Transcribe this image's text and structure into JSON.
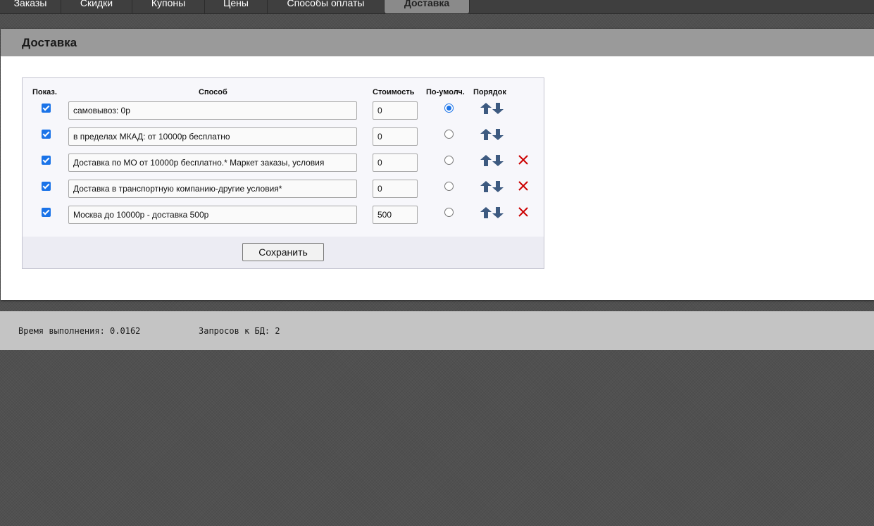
{
  "tabs": [
    {
      "label": "Заказы",
      "active": false
    },
    {
      "label": "Скидки",
      "active": false
    },
    {
      "label": "Купоны",
      "active": false
    },
    {
      "label": "Цены",
      "active": false
    },
    {
      "label": "Способы оплаты",
      "active": false
    },
    {
      "label": "Доставка",
      "active": true
    }
  ],
  "panel": {
    "title": "Доставка"
  },
  "table": {
    "headers": {
      "show": "Показ.",
      "method": "Способ",
      "cost": "Стоимость",
      "default": "По-умолч.",
      "order": "Порядок"
    },
    "rows": [
      {
        "show": true,
        "method": "самовывоз: 0р",
        "cost": "0",
        "default": true,
        "deletable": false
      },
      {
        "show": true,
        "method": "в пределах МКАД: от 10000р бесплатно",
        "cost": "0",
        "default": false,
        "deletable": false
      },
      {
        "show": true,
        "method": "Доставка по МО от 10000р бесплатно.* Маркет заказы, условия",
        "cost": "0",
        "default": false,
        "deletable": true
      },
      {
        "show": true,
        "method": "Доставка в транспортную компанию-другие условия*",
        "cost": "0",
        "default": false,
        "deletable": true
      },
      {
        "show": true,
        "method": "Москва до 10000р - доставка 500р",
        "cost": "500",
        "default": false,
        "deletable": true
      }
    ],
    "save_label": "Сохранить"
  },
  "status": {
    "exec_time": "Время выполнения: 0.0162",
    "db_queries": "Запросов к БД: 2"
  },
  "icons": {
    "order_up": "arrow-up-icon",
    "order_down": "arrow-down-icon",
    "delete": "close-icon"
  },
  "colors": {
    "accent": "#1a73e8",
    "arrow": "#3d5a80",
    "delete": "#cc0000"
  }
}
